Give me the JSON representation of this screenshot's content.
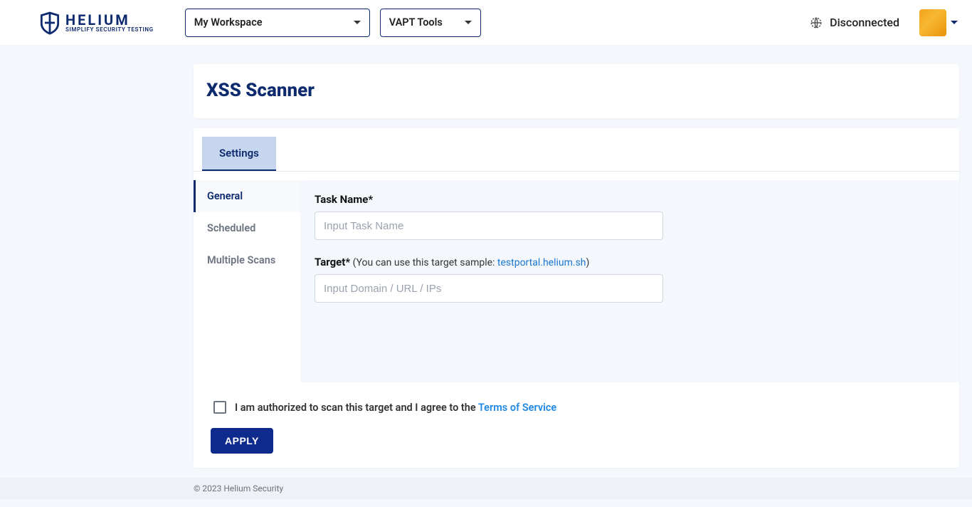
{
  "header": {
    "brand": "HELIUM",
    "tagline": "SIMPLIFY SECURITY TESTING",
    "workspace_label": "My Workspace",
    "tools_label": "VAPT Tools",
    "status": "Disconnected"
  },
  "page": {
    "title": "XSS Scanner",
    "tab_label": "Settings",
    "sidenav": {
      "general": "General",
      "scheduled": "Scheduled",
      "multiple": "Multiple Scans"
    },
    "form": {
      "task_label": "Task Name*",
      "task_placeholder": "Input Task Name",
      "target_label": "Target*",
      "target_hint_prefix": "(You can use this target sample: ",
      "target_hint_link": "testportal.helium.sh",
      "target_hint_suffix": ")",
      "target_placeholder": "Input Domain / URL / IPs"
    },
    "consent": {
      "text_prefix": "I am authorized to scan this target and I agree to the ",
      "tos_link": "Terms of Service"
    },
    "apply_label": "APPLY"
  },
  "footer": {
    "copyright": "© 2023 Helium Security"
  }
}
